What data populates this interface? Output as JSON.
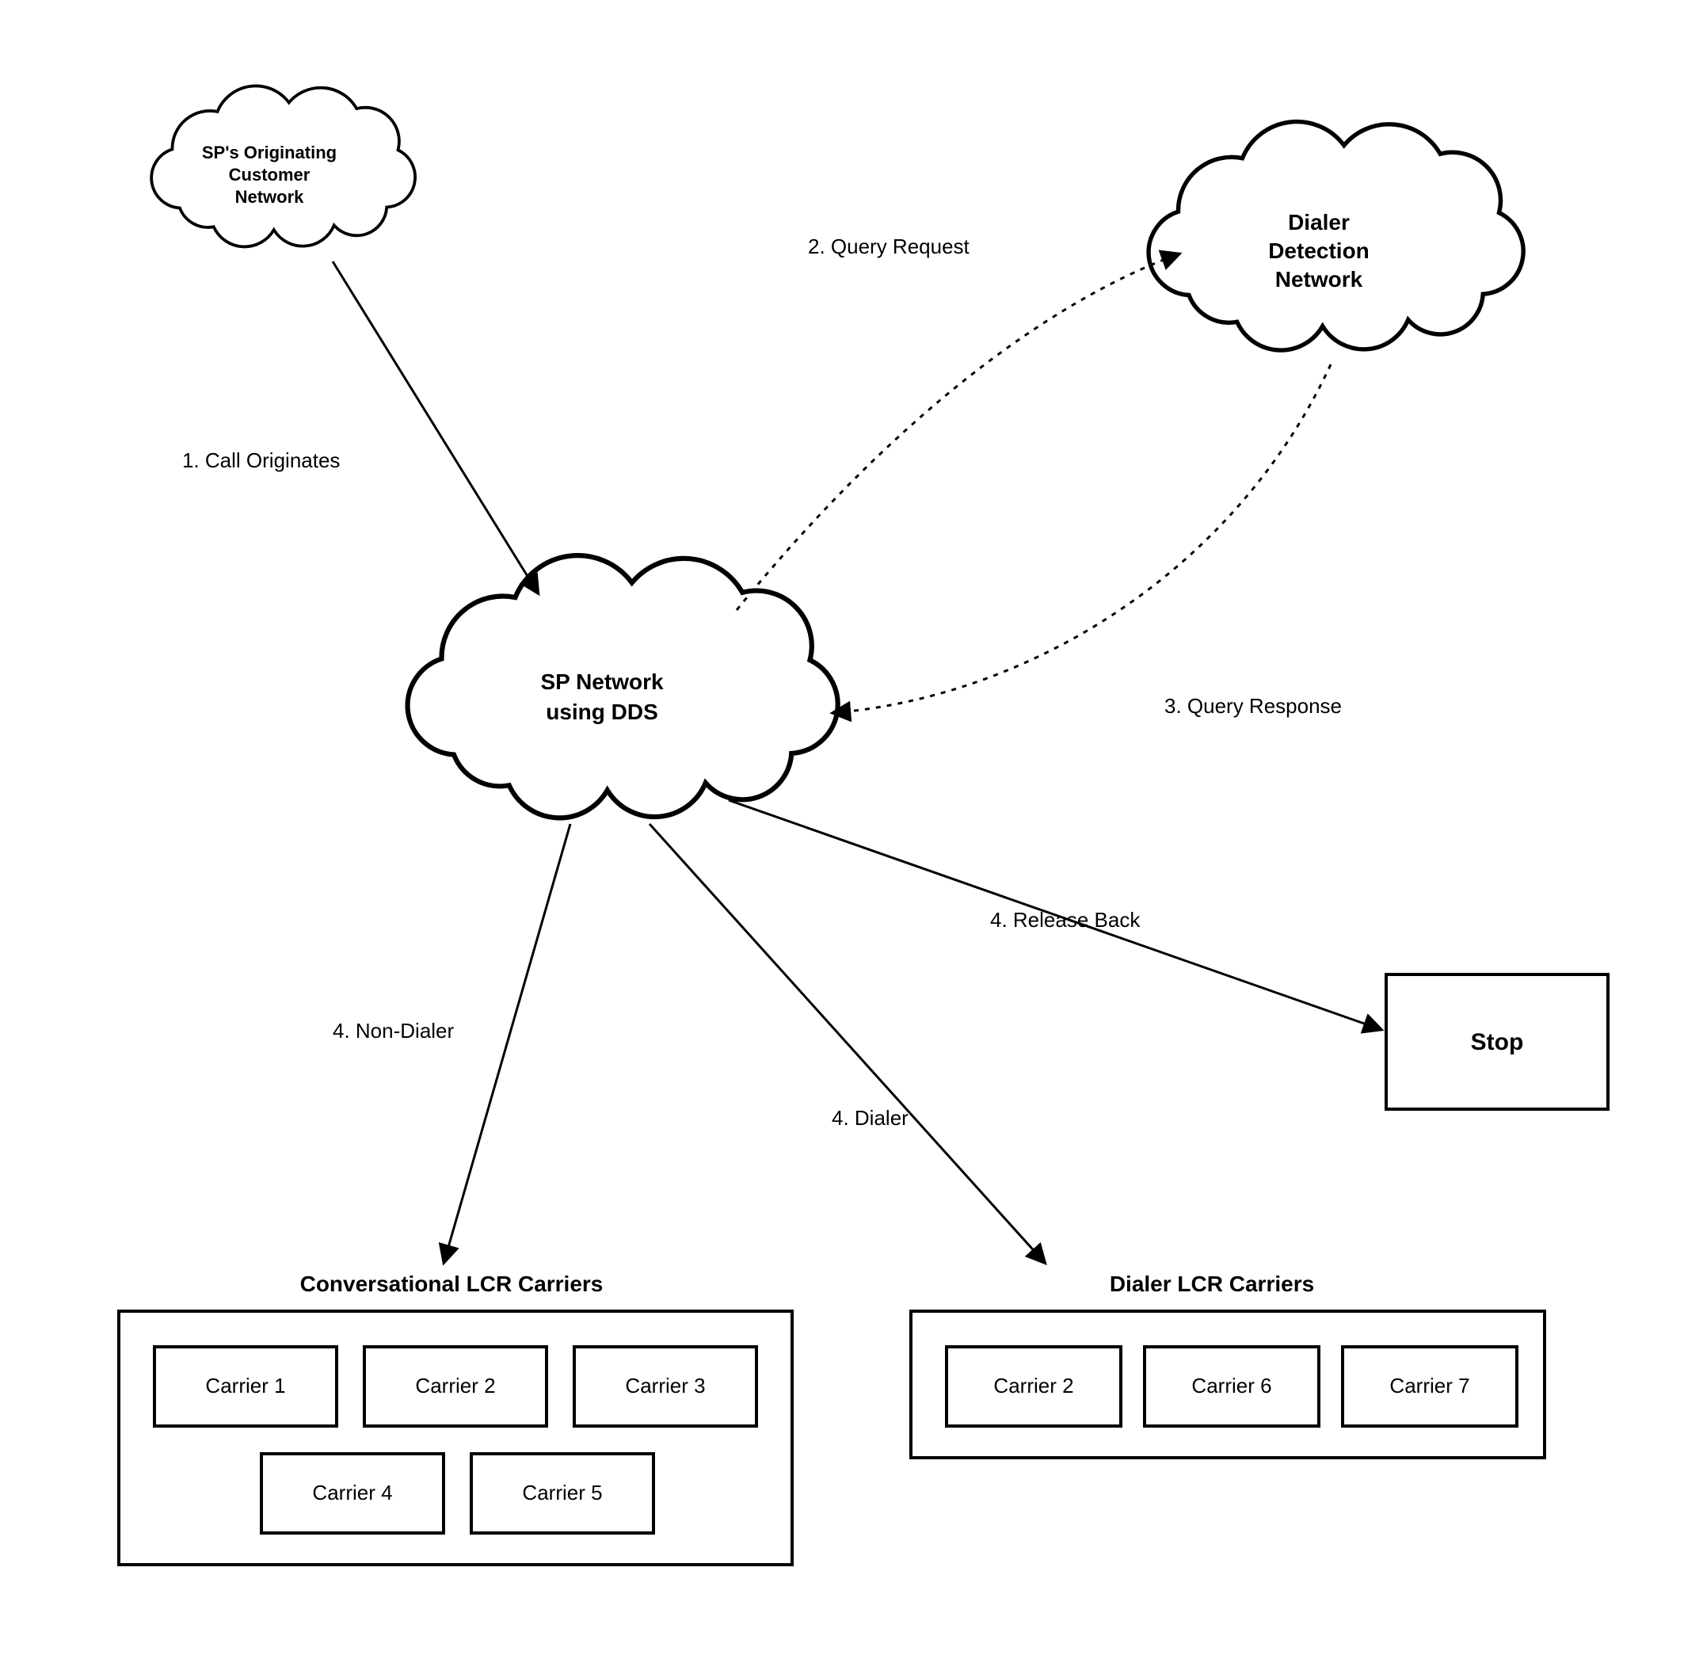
{
  "nodes": {
    "origin": {
      "l1": "SP's Originating",
      "l2": "Customer",
      "l3": "Network"
    },
    "ddn": {
      "l1": "Dialer",
      "l2": "Detection",
      "l3": "Network"
    },
    "sp": {
      "l1": "SP Network",
      "l2": "using DDS"
    },
    "stop": {
      "label": "Stop"
    }
  },
  "edges": {
    "e1": "1.  Call Originates",
    "e2": "2.  Query Request",
    "e3": "3.  Query Response",
    "e4a": "4.  Non-Dialer",
    "e4b": "4.  Dialer",
    "e4c": "4.  Release Back"
  },
  "groups": {
    "conv": {
      "title": "Conversational LCR Carriers",
      "carriers": [
        "Carrier 1",
        "Carrier 2",
        "Carrier 3",
        "Carrier 4",
        "Carrier 5"
      ]
    },
    "dialer": {
      "title": "Dialer LCR Carriers",
      "carriers": [
        "Carrier 2",
        "Carrier 6",
        "Carrier 7"
      ]
    }
  }
}
